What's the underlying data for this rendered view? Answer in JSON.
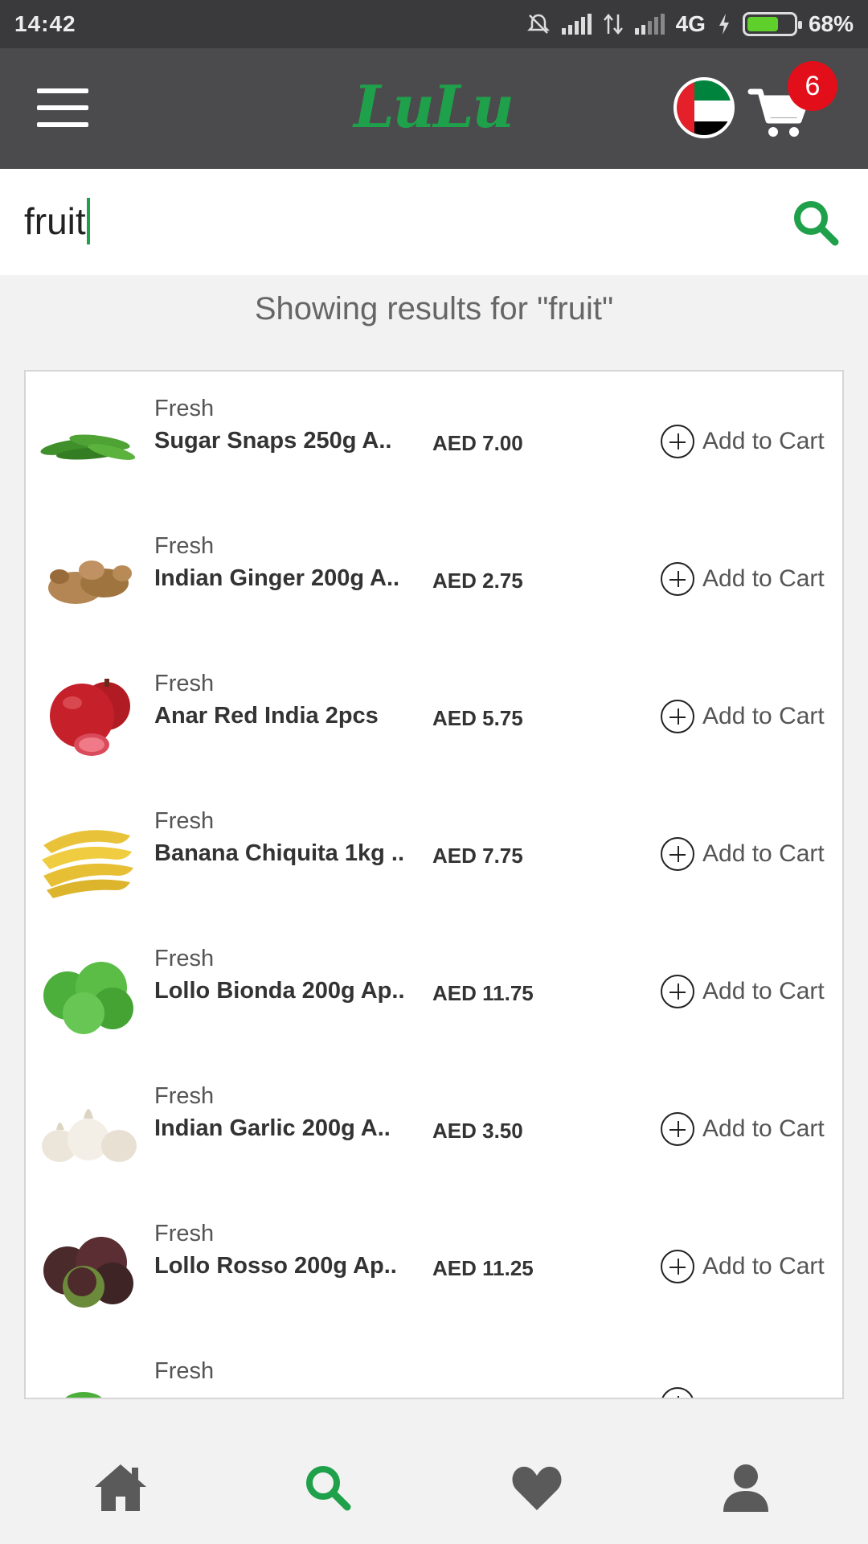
{
  "status_bar": {
    "time": "14:42",
    "network": "4G",
    "battery": "68%",
    "battery_level": 0.68
  },
  "app_bar": {
    "logo": "LuLu",
    "cart_count": "6"
  },
  "search": {
    "query": "fruit"
  },
  "results_heading": "Showing results for  \"fruit\"",
  "products": [
    {
      "category": "Fresh",
      "name": "Sugar Snaps 250g A..",
      "price": "AED 7.00",
      "action": "Add to Cart",
      "image": "sugar-snaps"
    },
    {
      "category": "Fresh",
      "name": "Indian Ginger 200g A..",
      "price": "AED 2.75",
      "action": "Add to Cart",
      "image": "ginger"
    },
    {
      "category": "Fresh",
      "name": "Anar Red India 2pcs",
      "price": "AED 5.75",
      "action": "Add to Cart",
      "image": "pomegranate"
    },
    {
      "category": "Fresh",
      "name": "Banana Chiquita 1kg ..",
      "price": "AED 7.75",
      "action": "Add to Cart",
      "image": "banana"
    },
    {
      "category": "Fresh",
      "name": "Lollo Bionda 200g Ap..",
      "price": "AED 11.75",
      "action": "Add to Cart",
      "image": "lettuce-green"
    },
    {
      "category": "Fresh",
      "name": "Indian Garlic 200g A..",
      "price": "AED 3.50",
      "action": "Add to Cart",
      "image": "garlic"
    },
    {
      "category": "Fresh",
      "name": "Lollo Rosso 200g Ap..",
      "price": "AED 11.25",
      "action": "Add to Cart",
      "image": "lettuce-red"
    },
    {
      "category": "Fresh",
      "name": "",
      "price": "",
      "action": "",
      "image": "herb"
    }
  ],
  "bottom_nav": [
    {
      "icon": "home-icon"
    },
    {
      "icon": "search-icon",
      "active": true
    },
    {
      "icon": "heart-icon"
    },
    {
      "icon": "user-icon"
    }
  ],
  "colors": {
    "accent": "#1fa04a",
    "appbar": "#4b4b4e",
    "badge": "#e20f1a"
  }
}
